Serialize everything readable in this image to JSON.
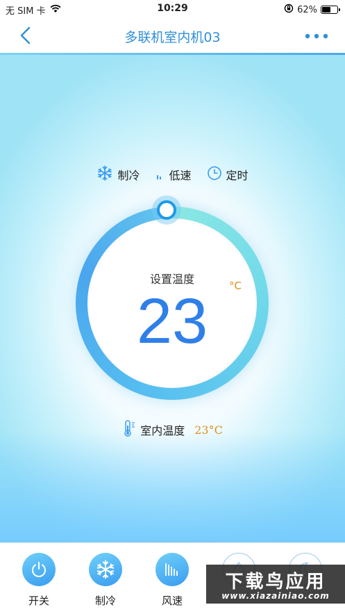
{
  "status_bar": {
    "carrier": "无 SIM 卡",
    "time": "10:29",
    "battery_percent": "62%",
    "battery_level": 0.62
  },
  "nav": {
    "title": "多联机室内机03",
    "back_icon": "chevron-left-icon",
    "more_icon": "more-dots-icon",
    "accent_color": "#2f8fd8"
  },
  "status_modes": [
    {
      "icon": "snowflake-icon",
      "label": "制冷"
    },
    {
      "icon": "fan-speed-low-icon",
      "label": "低速"
    },
    {
      "icon": "clock-icon",
      "label": "定时"
    }
  ],
  "dial": {
    "label": "设置温度",
    "value": "23",
    "unit": "°C",
    "value_color": "#2f7fe8",
    "unit_color": "#e08a1a"
  },
  "indoor": {
    "icon": "thermometer-icon",
    "label": "室内温度",
    "value": "23°C"
  },
  "toolbar": {
    "items": [
      {
        "icon": "power-icon",
        "label": "开关"
      },
      {
        "icon": "snowflake-icon",
        "label": "制冷"
      },
      {
        "icon": "fan-speed-icon",
        "label": "风速"
      },
      {
        "icon": "droplet-icon",
        "label": ""
      },
      {
        "icon": "moon-icon",
        "label": ""
      }
    ]
  },
  "watermark": {
    "title": "下载鸟应用",
    "url": "www.xiazainiao.com"
  }
}
